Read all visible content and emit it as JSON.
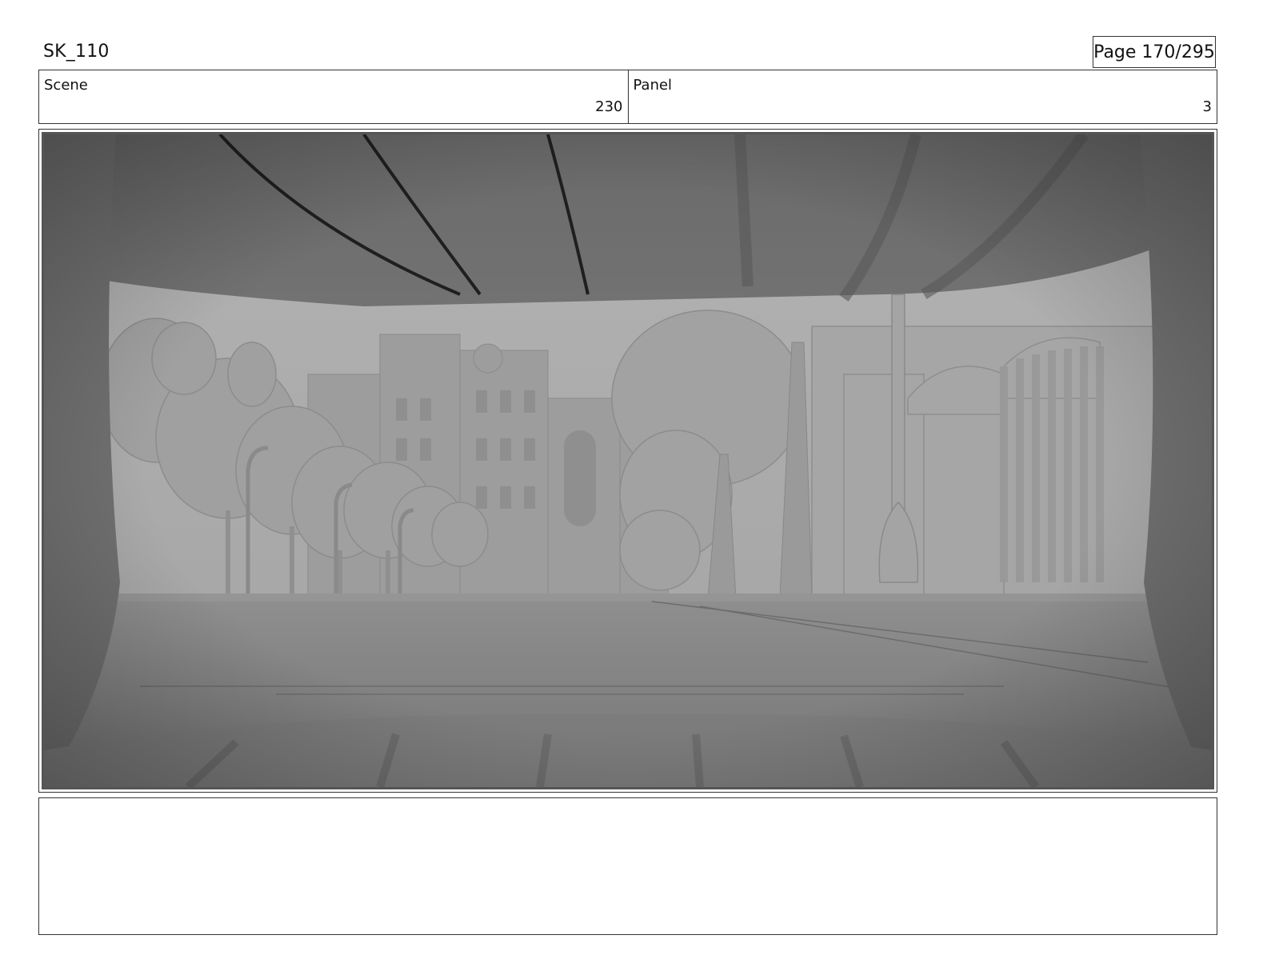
{
  "header": {
    "doc_id": "SK_110",
    "page": "Page 170/295"
  },
  "info": {
    "scene_label": "Scene",
    "scene_value": "230",
    "panel_label": "Panel",
    "panel_value": "3"
  },
  "panel_image": {
    "description_icon": "storyboard-frame-icon",
    "colors": {
      "sky": "#a9a9a9",
      "street": "#7f7f7f",
      "vignette": "#6e6e6e"
    }
  },
  "notes": {
    "text": ""
  }
}
